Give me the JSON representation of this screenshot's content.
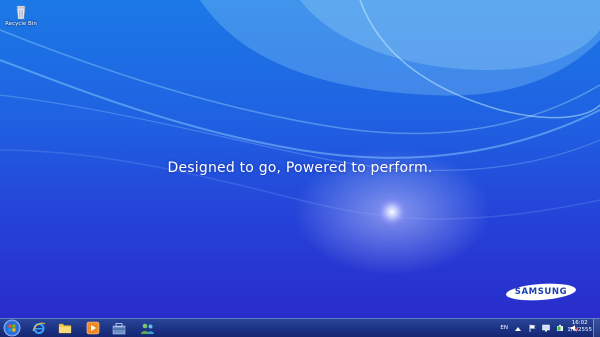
{
  "desktop": {
    "slogan": "Designed to go, Powered to perform.",
    "brand_logo_text": "SAMSUNG",
    "icons": [
      {
        "label": "Recycle Bin",
        "icon": "recycle-bin-icon"
      }
    ]
  },
  "taskbar": {
    "start_icon": "windows-start-icon",
    "pinned": [
      {
        "name": "internet-explorer",
        "icon": "internet-explorer-icon"
      },
      {
        "name": "file-explorer",
        "icon": "folder-icon"
      },
      {
        "name": "media-player",
        "icon": "media-player-icon"
      },
      {
        "name": "app-3",
        "icon": "toolbox-icon"
      },
      {
        "name": "app-4",
        "icon": "people-icon"
      }
    ],
    "tray": {
      "language": "EN",
      "icons": [
        "show-hidden-icons-arrow",
        "action-center-flag-icon",
        "network-icon",
        "power-icon",
        "volume-icon"
      ]
    },
    "clock": {
      "time": "16:02",
      "date": "1/6/2555"
    }
  },
  "colors": {
    "desktop_top": "#1b79e6",
    "desktop_bottom": "#2a28c8",
    "taskbar": "#1a2f7a",
    "logo_blue": "#1a3fb0"
  }
}
